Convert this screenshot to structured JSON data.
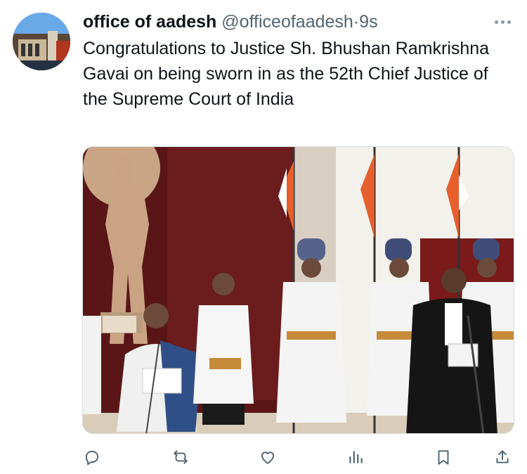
{
  "tweet": {
    "display_name": "office of aadesh",
    "handle": "@officeofaadesh",
    "separator": "·",
    "time": "9s",
    "text": "Congratulations to Justice Sh. Bhushan Ramkrishna Gavai on being sworn in as the 52th Chief Justice of the Supreme Court of India"
  },
  "icons": {
    "avatar": "avatar",
    "more": "more-icon",
    "reply": "reply-icon",
    "retweet": "retweet-icon",
    "like": "like-icon",
    "views": "views-icon",
    "bookmark": "bookmark-icon",
    "share": "share-icon"
  },
  "colors": {
    "text": "#0f1419",
    "secondary": "#536471",
    "icon": "#536471"
  }
}
